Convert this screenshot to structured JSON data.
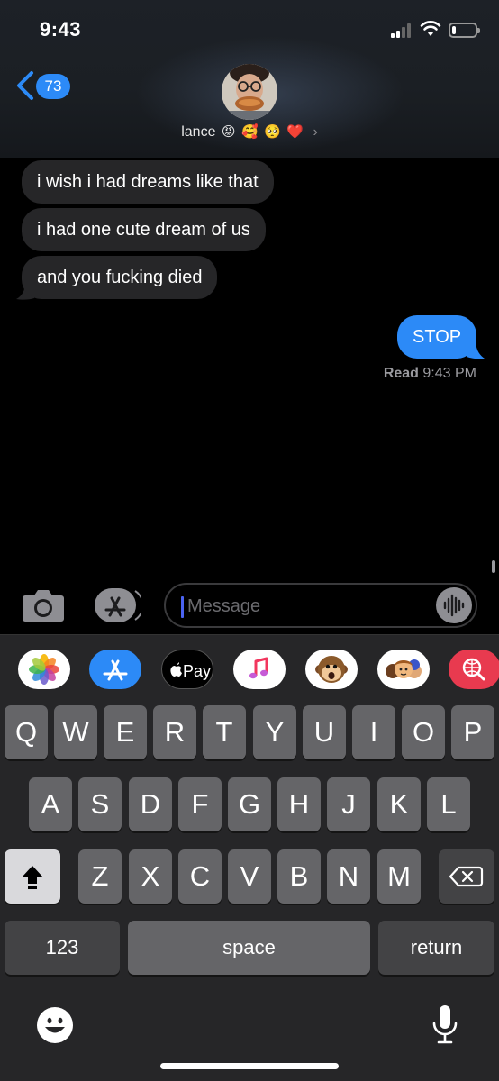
{
  "status_bar": {
    "time": "9:43"
  },
  "header": {
    "back_badge": "73",
    "contact_name": "lance",
    "contact_emojis": [
      "😡",
      "🥰",
      "🥺",
      "❤️"
    ]
  },
  "messages": [
    {
      "direction": "in",
      "text": "i wish i had dreams like that"
    },
    {
      "direction": "in",
      "text": "i had one cute dream of us"
    },
    {
      "direction": "in",
      "text": "and you fucking died"
    },
    {
      "direction": "out",
      "text": "STOP"
    }
  ],
  "read_receipt": {
    "label": "Read",
    "time": "9:43 PM"
  },
  "input": {
    "placeholder": "Message"
  },
  "app_drawer": {
    "apps": [
      "photos-icon",
      "app-store-icon",
      "apple-pay-icon",
      "music-icon",
      "monkey-memoji-icon",
      "memoji-group-icon",
      "web-search-icon"
    ],
    "apple_pay_label": "Pay"
  },
  "keyboard": {
    "row1": [
      "Q",
      "W",
      "E",
      "R",
      "T",
      "Y",
      "U",
      "I",
      "O",
      "P"
    ],
    "row2": [
      "A",
      "S",
      "D",
      "F",
      "G",
      "H",
      "J",
      "K",
      "L"
    ],
    "row3": [
      "Z",
      "X",
      "C",
      "V",
      "B",
      "N",
      "M"
    ],
    "numbers_label": "123",
    "space_label": "space",
    "return_label": "return"
  },
  "colors": {
    "accent_blue": "#2c8af7",
    "incoming_bubble": "#262628",
    "keyboard_bg": "#262628"
  }
}
